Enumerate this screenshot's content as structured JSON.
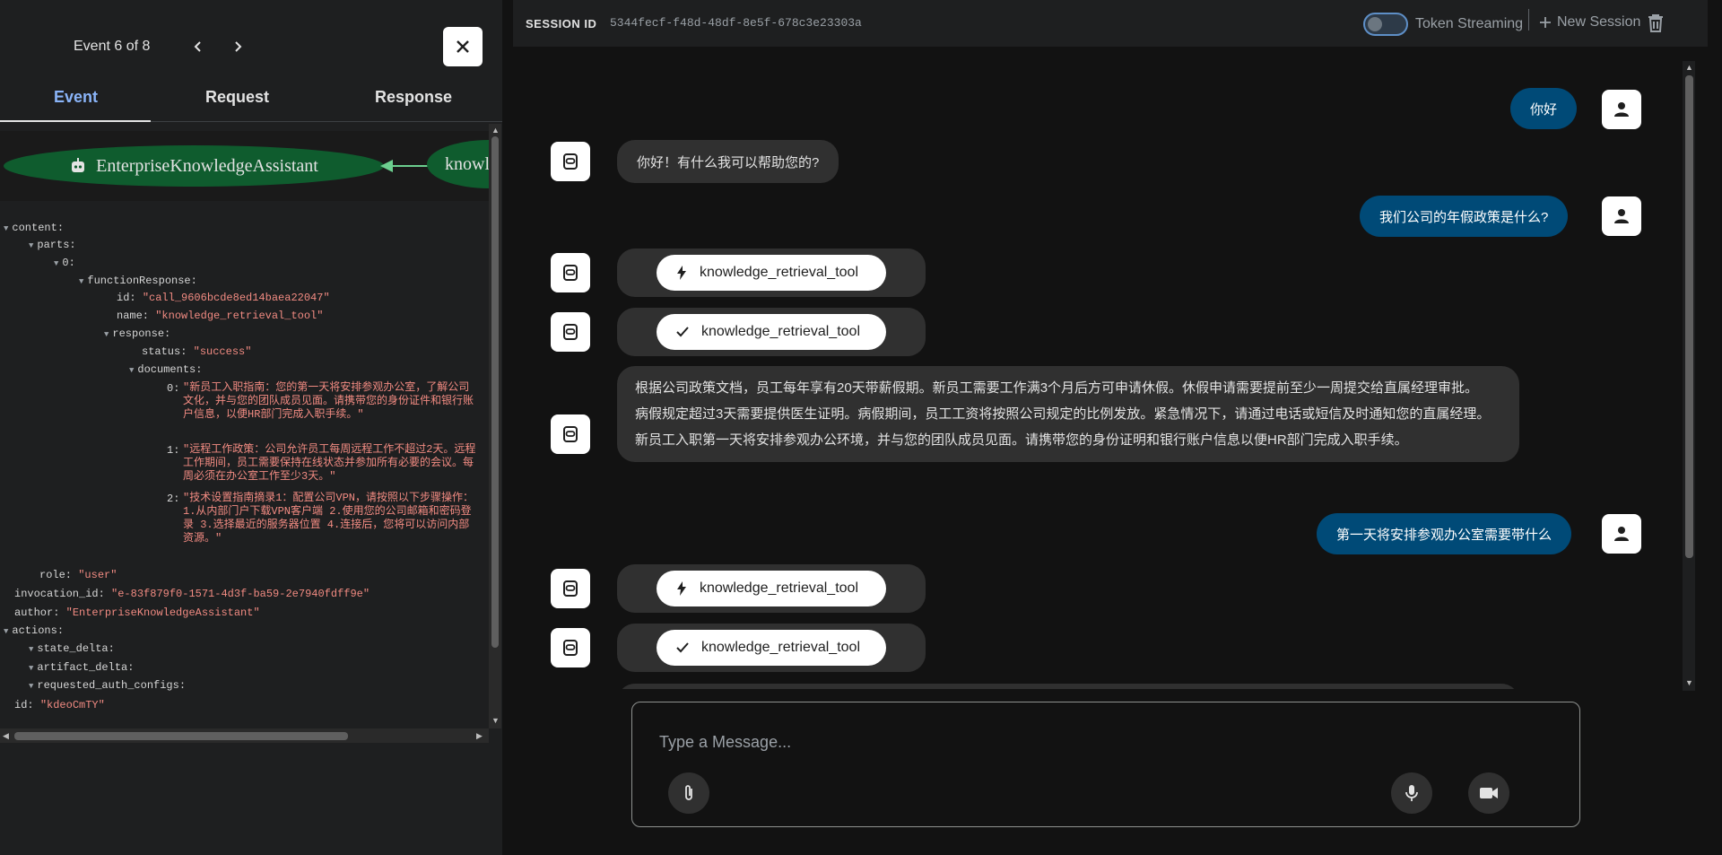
{
  "event_panel": {
    "counter": "Event 6 of 8",
    "tabs": [
      "Event",
      "Request",
      "Response"
    ],
    "graph": {
      "agent_node": "EnterpriseKnowledgeAssistant",
      "tool_node": "knowledge_retrieval_tool"
    },
    "json": {
      "content": "content:",
      "parts": "parts:",
      "idx0": "0:",
      "functionResponse": "functionResponse:",
      "id_key": "id:",
      "id_val": "\"call_9606bcde8ed14baea22047\"",
      "name_key": "name:",
      "name_val": "\"knowledge_retrieval_tool\"",
      "response": "response:",
      "status_key": "status:",
      "status_val": "\"success\"",
      "documents": "documents:",
      "doc0_key": "0:",
      "doc0_val": "\"新员工入职指南：您的第一天将安排参观办公室，了解公司文化，并与您的团队成员见面。请携带您的身份证件和银行账户信息，以便HR部门完成入职手续。\"",
      "doc1_key": "1:",
      "doc1_val": "\"远程工作政策：公司允许员工每周远程工作不超过2天。远程工作期间，员工需要保持在线状态并参加所有必要的会议。每周必须在办公室工作至少3天。\"",
      "doc2_key": "2:",
      "doc2_val": "\"技术设置指南摘录1：配置公司VPN，请按照以下步骤操作：1.从内部门户下载VPN客户端 2.使用您的公司邮箱和密码登录 3.选择最近的服务器位置 4.连接后，您将可以访问内部资源。\"",
      "role_key": "role:",
      "role_val": "\"user\"",
      "invocation_key": "invocation_id:",
      "invocation_val": "\"e-83f879f0-1571-4d3f-ba59-2e7940fdff9e\"",
      "author_key": "author:",
      "author_val": "\"EnterpriseKnowledgeAssistant\"",
      "actions": "actions:",
      "state_delta": "state_delta:",
      "artifact_delta": "artifact_delta:",
      "requested_auth_configs": "requested_auth_configs:",
      "eid_key": "id:",
      "eid_val": "\"kdeoCmTY\""
    }
  },
  "session": {
    "label": "SESSION ID",
    "id": "5344fecf-f48d-48df-8e5f-678c3e23303a",
    "token_streaming": "Token Streaming",
    "token_streaming_on": false,
    "new_session": "New Session"
  },
  "messages": {
    "m1_user": "你好",
    "m2_bot": "你好！有什么我可以帮助您的?",
    "m3_user": "我们公司的年假政策是什么?",
    "tool_name": "knowledge_retrieval_tool",
    "m6_p1": "根据公司政策文档，员工每年享有20天带薪假期。新员工需要工作满3个月后方可申请休假。休假申请需要提前至少一周提交给直属经理审批。",
    "m6_p2": "病假规定超过3天需要提供医生证明。病假期间，员工工资将按照公司规定的比例发放。紧急情况下，请通过电话或短信及时通知您的直属经理。",
    "m6_p3": "新员工入职第一天将安排参观办公环境，并与您的团队成员见面。请携带您的身份证明和银行账户信息以便HR部门完成入职手续。",
    "m7_user": "第一天将安排参观办公室需要带什么"
  },
  "composer": {
    "placeholder": "Type a Message..."
  },
  "colors": {
    "user_bubble": "#004a77",
    "bot_bubble": "#303030",
    "graph_node": "#0f5c2e",
    "accent": "#8ab4f8",
    "json_string": "#f28b82"
  },
  "icons": [
    "chevron-left-icon",
    "chevron-right-icon",
    "close-icon",
    "robot-icon",
    "wrench-icon",
    "plus-icon",
    "trash-icon",
    "person-icon",
    "bolt-icon",
    "check-icon",
    "paperclip-icon",
    "mic-icon",
    "videocam-icon"
  ]
}
